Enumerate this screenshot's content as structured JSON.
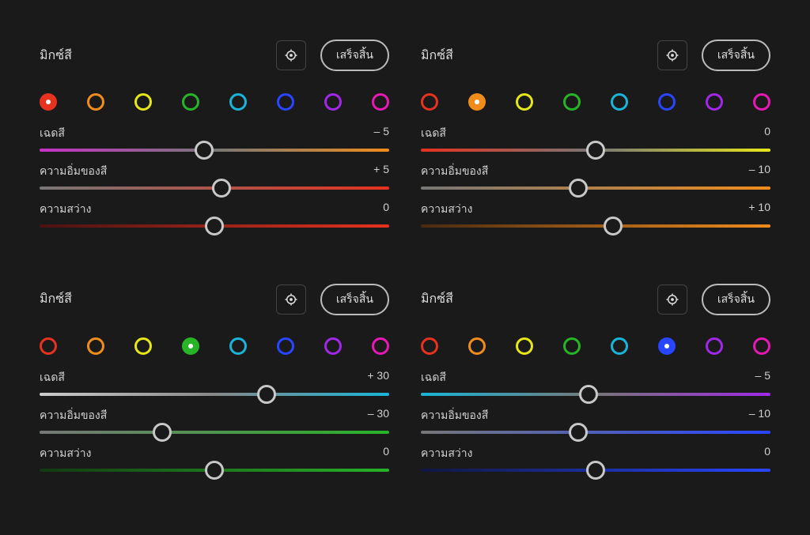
{
  "title": "มิกซ์สี",
  "done_label": "เสร็จสิ้น",
  "target_icon": "target-icon",
  "swatch_colors": [
    "#e6321e",
    "#f08c1c",
    "#e6e619",
    "#27b427",
    "#19b4d7",
    "#2846ff",
    "#a028e6",
    "#e619b4"
  ],
  "sliders": [
    {
      "label": "เฉดสี",
      "key": "hue"
    },
    {
      "label": "ความอิ่มของสี",
      "key": "sat"
    },
    {
      "label": "ความสว่าง",
      "key": "lum"
    }
  ],
  "panels": [
    {
      "selected": 0,
      "selected_fill": true,
      "hue": {
        "value": "– 5",
        "pos": 47,
        "left": "#c832c8",
        "right": "#f08c1c",
        "neutral": "#777"
      },
      "sat": {
        "value": "+ 5",
        "pos": 52,
        "left": "#777",
        "right": "#e6321e"
      },
      "lum": {
        "value": "0",
        "pos": 50,
        "left": "#4a1212",
        "right": "#e6321e"
      }
    },
    {
      "selected": 1,
      "selected_fill": true,
      "hue": {
        "value": "0",
        "pos": 50,
        "left": "#e6321e",
        "right": "#e6e619",
        "neutral": "#777"
      },
      "sat": {
        "value": "– 10",
        "pos": 45,
        "left": "#777",
        "right": "#f08c1c"
      },
      "lum": {
        "value": "+ 10",
        "pos": 55,
        "left": "#4a2a10",
        "right": "#f08c1c"
      }
    },
    {
      "selected": 3,
      "selected_fill": true,
      "hue": {
        "value": "+ 30",
        "pos": 65,
        "left": "#cccccc",
        "right": "#19b4d7",
        "neutral": "#888"
      },
      "sat": {
        "value": "– 30",
        "pos": 35,
        "left": "#777",
        "right": "#27b427"
      },
      "lum": {
        "value": "0",
        "pos": 50,
        "left": "#123a12",
        "right": "#27b427"
      }
    },
    {
      "selected": 5,
      "selected_fill": true,
      "hue": {
        "value": "– 5",
        "pos": 48,
        "left": "#19b4d7",
        "right": "#a028e6",
        "neutral": "#777"
      },
      "sat": {
        "value": "– 10",
        "pos": 45,
        "left": "#777",
        "right": "#2846ff"
      },
      "lum": {
        "value": "0",
        "pos": 50,
        "left": "#0f1640",
        "right": "#2846ff"
      }
    }
  ]
}
